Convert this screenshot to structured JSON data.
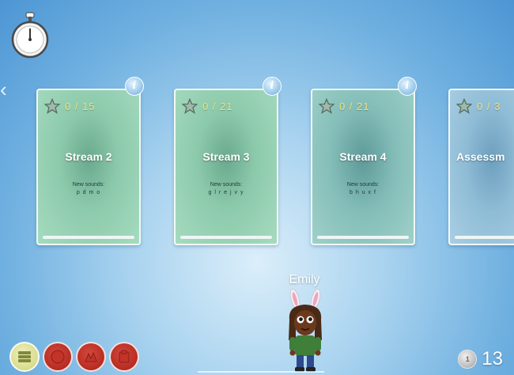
{
  "player": {
    "name": "Emily"
  },
  "coins": {
    "count": "13",
    "coin_symbol": "1"
  },
  "info_symbol": "i",
  "stopwatch": {
    "icon": "stopwatch-icon"
  },
  "cards": [
    {
      "score": "0 / 15",
      "title": "Stream 2",
      "new_label": "New sounds:",
      "sounds": "p d m o",
      "progress": 0,
      "color": "green"
    },
    {
      "score": "0 / 21",
      "title": "Stream 3",
      "new_label": "New sounds:",
      "sounds": "g l r e j v y",
      "progress": 0,
      "color": "green"
    },
    {
      "score": "0 / 21",
      "title": "Stream 4",
      "new_label": "New sounds:",
      "sounds": "b h u x f",
      "progress": 0,
      "color": "teal"
    },
    {
      "score": "0 / 3",
      "title": "Assessm",
      "progress": 0,
      "color": "blue"
    }
  ],
  "bottom_buttons": [
    {
      "icon": "menu-list-icon",
      "color": "#d6dc8c"
    },
    {
      "icon": "red-button-icon",
      "color": "#b82b22"
    },
    {
      "icon": "red-button-icon",
      "color": "#b82b22"
    },
    {
      "icon": "red-button-icon",
      "color": "#b82b22"
    }
  ],
  "colors": {
    "score": "#f5e27a",
    "background": "#6fb0e0"
  }
}
